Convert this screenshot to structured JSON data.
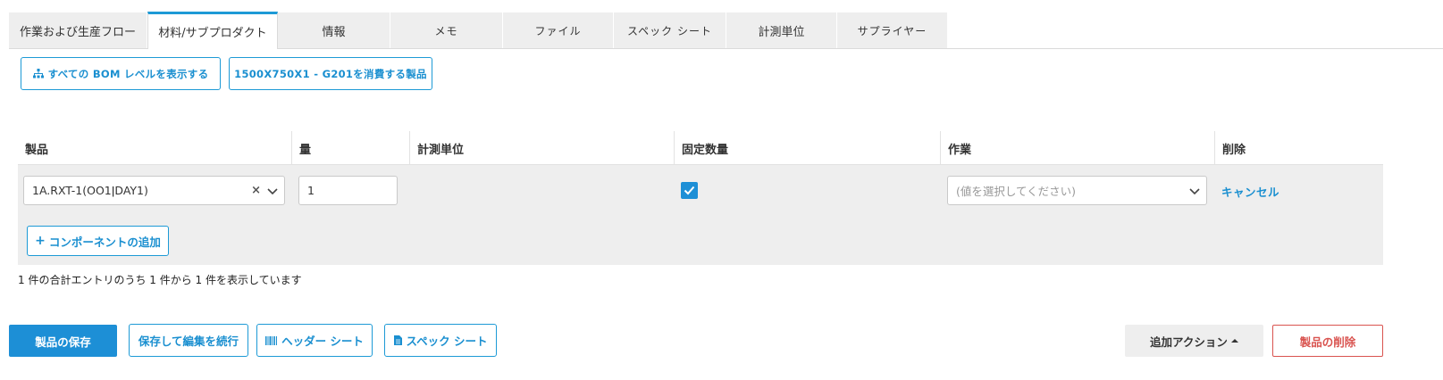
{
  "tabs": [
    {
      "label": "作業および生産フロー"
    },
    {
      "label": "材料/サブプロダクト"
    },
    {
      "label": "情報"
    },
    {
      "label": "メモ"
    },
    {
      "label": "ファイル"
    },
    {
      "label": "スペック シート"
    },
    {
      "label": "計測単位"
    },
    {
      "label": "サプライヤー"
    }
  ],
  "active_tab": "材料/サブプロダクト",
  "actions": {
    "show_bom_levels": "すべての BOM レベルを表示する",
    "consuming_products": "1500X750X1 - G201を消費する製品"
  },
  "table": {
    "headers": [
      "製品",
      "量",
      "計測単位",
      "固定数量",
      "作業",
      "削除"
    ],
    "rows": [
      {
        "product": "1A.RXT-1(OO1ǀDAY1)",
        "quantity": "1",
        "unit": "",
        "fixed_quantity": true,
        "operation_placeholder": "(値を選択してください)",
        "delete_action": "キャンセル"
      }
    ],
    "add_component": "コンポーネントの追加"
  },
  "entries_info": "1 件の合計エントリのうち 1 件から 1 件を表示しています",
  "footer": {
    "save_product": "製品の保存",
    "save_continue": "保存して編集を続行",
    "header_sheet": "ヘッダー シート",
    "spec_sheet": "スペック シート",
    "more_actions": "追加アクション",
    "delete_product": "製品の削除"
  },
  "colors": {
    "accent": "#1d8fd6",
    "danger": "#d9534f",
    "row_bg": "#eeeeee"
  }
}
